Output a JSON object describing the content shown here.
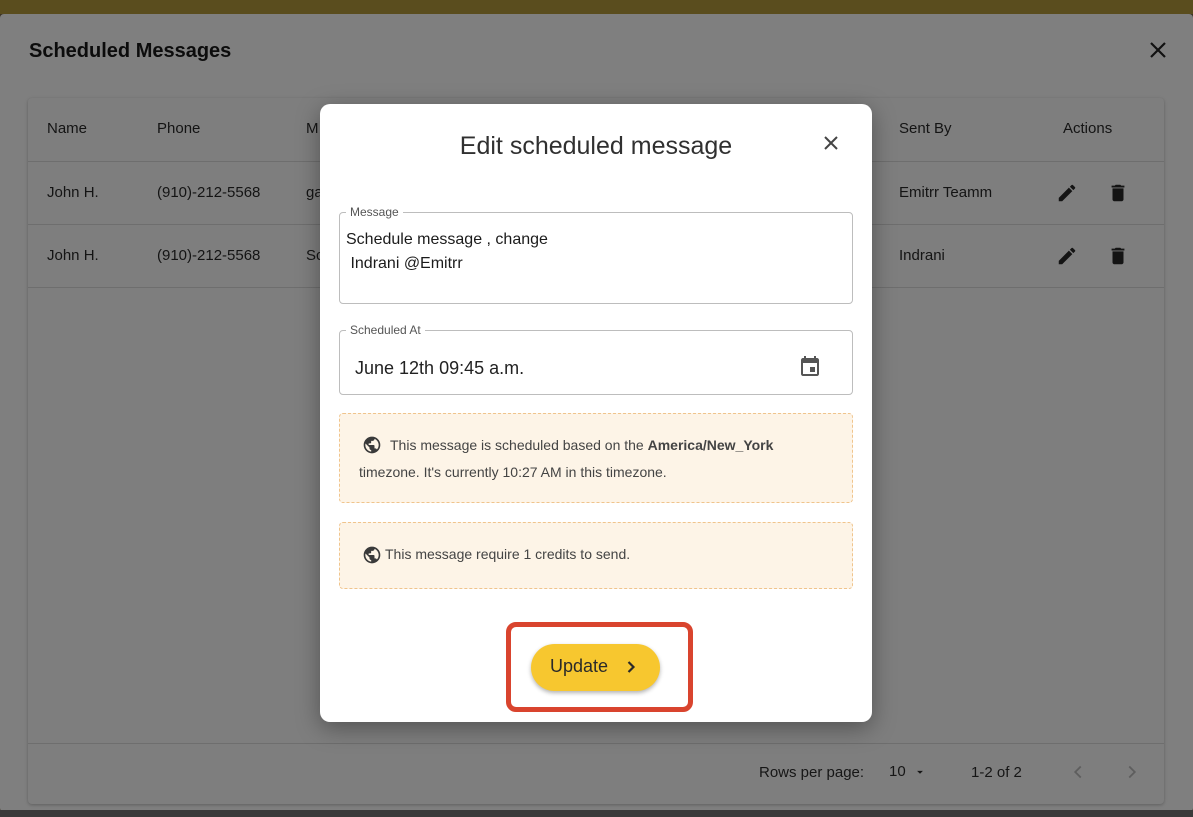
{
  "outer_dialog": {
    "title": "Scheduled Messages",
    "close_icon": "close-icon"
  },
  "table": {
    "headers": {
      "name": "Name",
      "phone": "Phone",
      "message": "M",
      "sent_by": "Sent By",
      "actions": "Actions"
    },
    "rows": [
      {
        "name": "John H.",
        "phone": "(910)-212-5568",
        "message": "ga",
        "sent_by": "Emitrr Teamm"
      },
      {
        "name": "John H.",
        "phone": "(910)-212-5568",
        "message": "Sc",
        "sent_by": "Indrani"
      }
    ],
    "footer": {
      "rows_per_page_label": "Rows per page:",
      "rows_per_page_value": "10",
      "range": "1-2 of 2"
    }
  },
  "modal": {
    "title": "Edit scheduled message",
    "message_label": "Message",
    "message_value": "Schedule message , change\n Indrani @Emitrr",
    "scheduled_label": "Scheduled At",
    "scheduled_value": "June 12th 09:45 a.m.",
    "timezone_info": {
      "prefix": "This message is scheduled based on the ",
      "timezone": "America/New_York",
      "line2": "timezone. It's currently 10:27 AM in this timezone."
    },
    "credits_info": "This message require 1 credits to send.",
    "update_button": "Update"
  },
  "colors": {
    "accent_button": "#f7c72f",
    "highlight": "#d9442e",
    "info_bg": "#fdf4e7"
  }
}
